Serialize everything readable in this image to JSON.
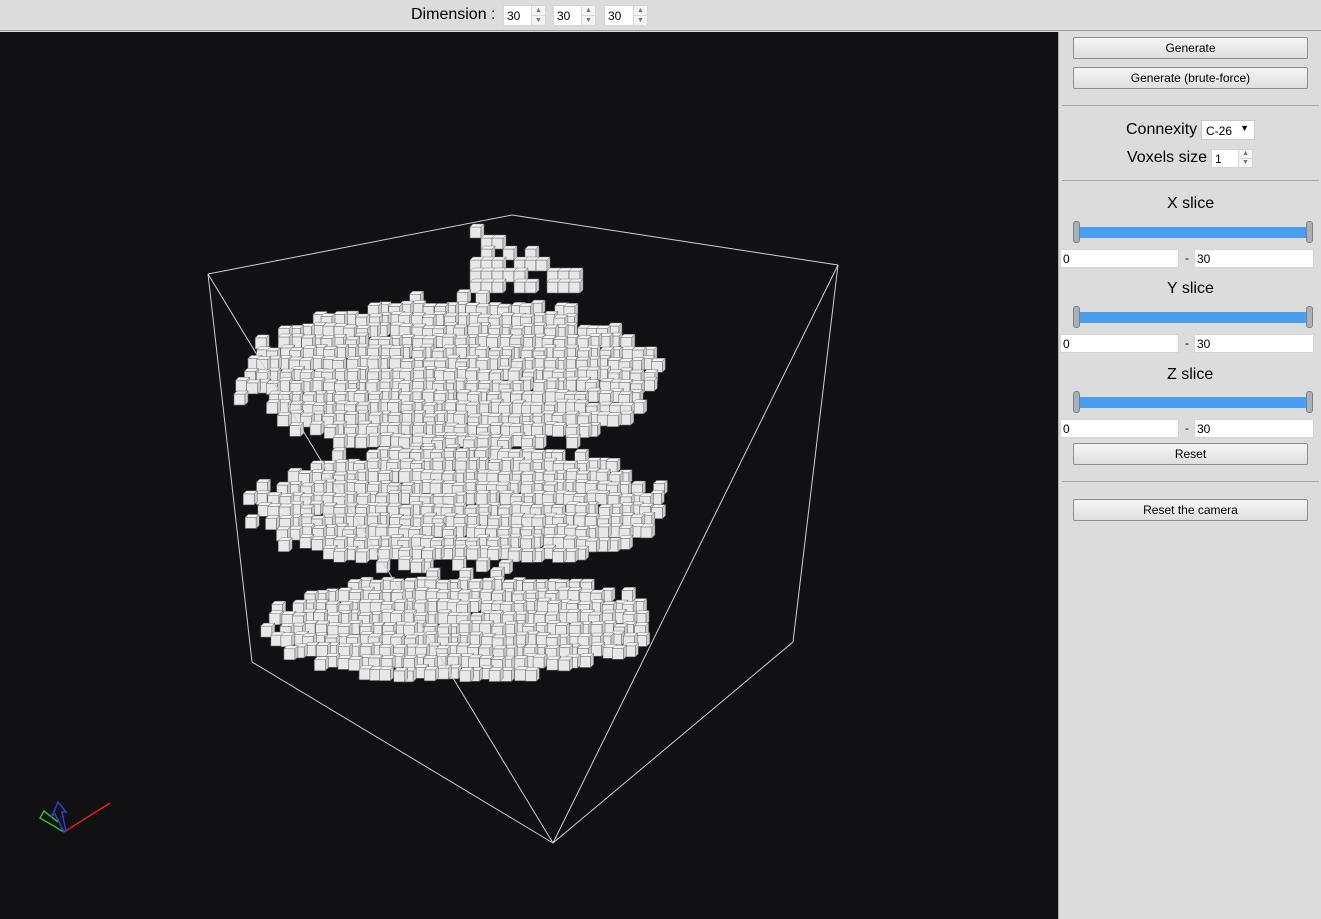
{
  "toolbar": {
    "dimension_label": "Dimension :",
    "dims": [
      "30",
      "30",
      "30"
    ]
  },
  "panel": {
    "generate_label": "Generate",
    "generate_brute_label": "Generate (brute-force)",
    "connexity_label": "Connexity",
    "connexity_value": "C-26",
    "voxels_size_label": "Voxels size",
    "voxels_size_value": "1",
    "x_slice": {
      "title": "X slice",
      "min": "0",
      "max": "30"
    },
    "y_slice": {
      "title": "Y slice",
      "min": "0",
      "max": "30"
    },
    "z_slice": {
      "title": "Z slice",
      "min": "0",
      "max": "30"
    },
    "reset_label": "Reset",
    "reset_camera_label": "Reset the camera",
    "range_separator": "-"
  },
  "viewport": {
    "background": "#111113",
    "voxel_color": "#e8e8e8",
    "bbox_color": "#cfcfcf",
    "axis_colors": {
      "x": "#e02020",
      "y": "#30c030",
      "z": "#2a40d0"
    }
  }
}
